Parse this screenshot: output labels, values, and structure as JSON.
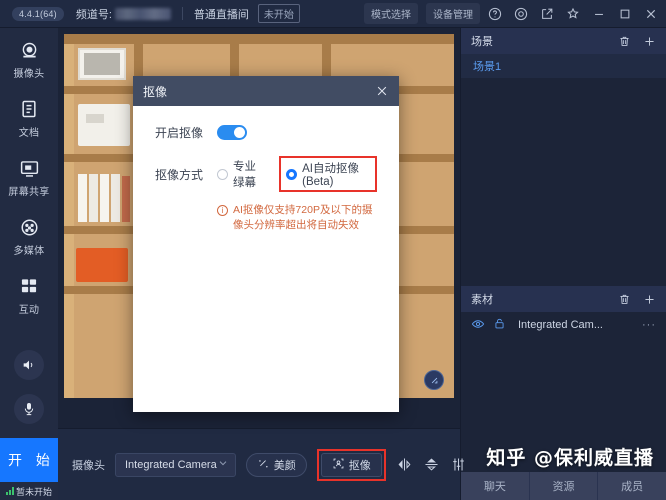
{
  "titlebar": {
    "version": "4.4.1(64)",
    "channel_label": "频道号:",
    "channel_value_masked": "",
    "room_type": "普通直播间",
    "room_status": "未开始",
    "mode_select": "模式选择",
    "device_manage": "设备管理",
    "icons": {
      "help": "help-circle-icon",
      "settings": "target-icon",
      "popout": "external-link-icon",
      "pin": "pin-icon",
      "minimize": "minimize-icon",
      "maximize": "maximize-icon",
      "close": "close-icon"
    }
  },
  "sidebar": {
    "items": [
      {
        "label": "摄像头",
        "icon": "camera-icon"
      },
      {
        "label": "文档",
        "icon": "document-icon"
      },
      {
        "label": "屏幕共享",
        "icon": "screen-share-icon"
      },
      {
        "label": "多媒体",
        "icon": "multimedia-icon"
      },
      {
        "label": "互动",
        "icon": "interaction-icon"
      }
    ],
    "speaker_icon": "speaker-icon",
    "mic_icon": "microphone-icon",
    "start_button": "开 始",
    "status_text": "暂未开始"
  },
  "modal": {
    "title": "抠像",
    "close_icon": "close-icon",
    "enable_label": "开启抠像",
    "enable_on": true,
    "mode_label": "抠像方式",
    "options": [
      {
        "label": "专业绿幕",
        "selected": false
      },
      {
        "label": "AI自动抠像(Beta)",
        "selected": true
      }
    ],
    "warning": "AI抠像仅支持720P及以下的摄像头分辨率超出将自动失效",
    "highlight_color": "#e8332a",
    "accent_color": "#1677ff"
  },
  "right_panel": {
    "scene": {
      "title": "场景",
      "delete_icon": "trash-icon",
      "add_icon": "plus-icon",
      "items": [
        {
          "label": "场景1"
        }
      ]
    },
    "asset": {
      "title": "素材",
      "delete_icon": "trash-icon",
      "add_icon": "plus-icon",
      "rows": [
        {
          "visible_icon": "eye-icon",
          "lock_icon": "unlock-icon",
          "name": "Integrated Cam...",
          "menu": "···"
        }
      ]
    }
  },
  "bottombar": {
    "camera_label": "摄像头",
    "camera_value": "Integrated Camera",
    "dropdown_icon": "chevron-down-icon",
    "beauty_button": "美颜",
    "beauty_icon": "sparkle-icon",
    "key_button": "抠像",
    "key_icon": "person-crop-icon",
    "key_highlighted": true,
    "flip_h_icon": "flip-horizontal-icon",
    "flip_v_icon": "flip-vertical-icon",
    "adjust_icon": "sliders-icon"
  },
  "tabs": [
    {
      "label": "聊天"
    },
    {
      "label": "资源"
    },
    {
      "label": "成员"
    }
  ],
  "watermark": "知乎 @保利威直播",
  "preview": {
    "resize_handle_icon": "resize-handle-icon"
  }
}
